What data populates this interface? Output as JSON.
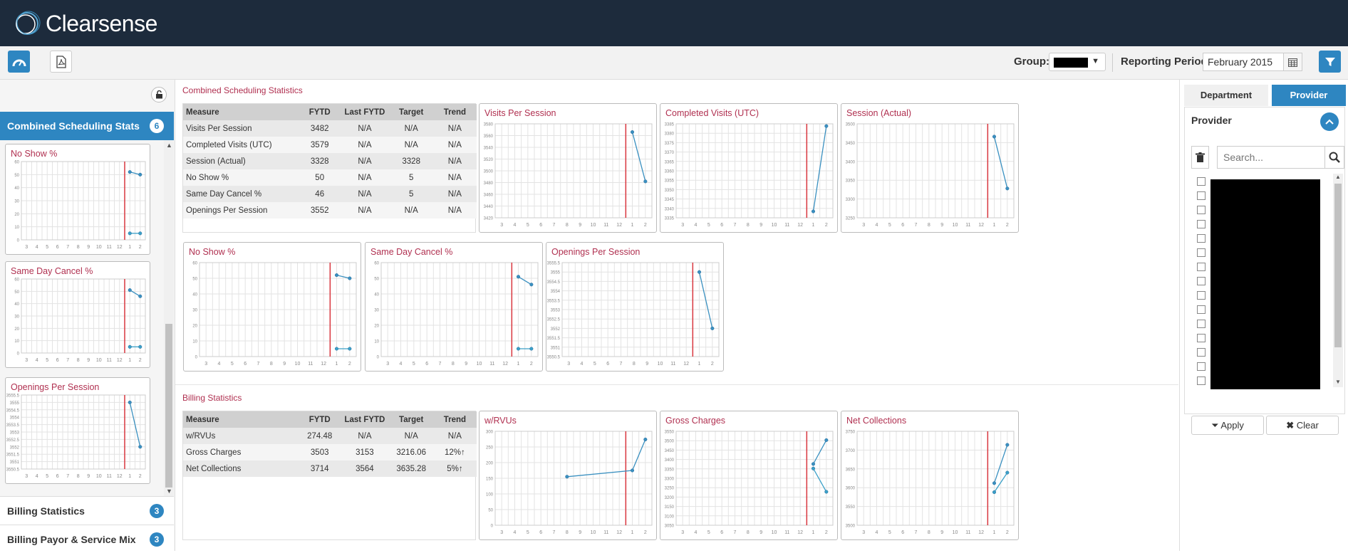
{
  "app": {
    "brand": "Clearsense"
  },
  "toolbar": {
    "group_label": "Group:",
    "period_label": "Reporting Period:",
    "period_value": "February 2015"
  },
  "colors": {
    "accent": "#2e86c1",
    "title": "#b03050",
    "redline": "#d9363e",
    "series": "#3a90c0"
  },
  "sidebar": {
    "selected": {
      "label": "Combined Scheduling Stats",
      "count": "6"
    },
    "items": [
      {
        "label": "Billing Statistics",
        "count": "3"
      },
      {
        "label": "Billing Payor & Service Mix",
        "count": "3"
      }
    ],
    "cards": [
      "No Show %",
      "Same Day Cancel %",
      "Openings Per Session"
    ]
  },
  "scheduling": {
    "title": "Combined Scheduling Statistics",
    "headers": [
      "Measure",
      "FYTD",
      "Last FYTD",
      "Target",
      "Trend"
    ],
    "rows": [
      [
        "Visits Per Session",
        "3482",
        "N/A",
        "N/A",
        "N/A"
      ],
      [
        "Completed Visits (UTC)",
        "3579",
        "N/A",
        "N/A",
        "N/A"
      ],
      [
        "Session (Actual)",
        "3328",
        "N/A",
        "3328",
        "N/A"
      ],
      [
        "No Show %",
        "50",
        "N/A",
        "5",
        "N/A"
      ],
      [
        "Same Day Cancel %",
        "46",
        "N/A",
        "5",
        "N/A"
      ],
      [
        "Openings Per Session",
        "3552",
        "N/A",
        "N/A",
        "N/A"
      ]
    ]
  },
  "billing": {
    "title": "Billing Statistics",
    "headers": [
      "Measure",
      "FYTD",
      "Last FYTD",
      "Target",
      "Trend"
    ],
    "rows": [
      [
        "w/RVUs",
        "274.48",
        "N/A",
        "N/A",
        "N/A"
      ],
      [
        "Gross Charges",
        "3503",
        "3153",
        "3216.06",
        "12%"
      ],
      [
        "Net Collections",
        "3714",
        "3564",
        "3635.28",
        "5%"
      ]
    ]
  },
  "chart_data": [
    {
      "id": "visits",
      "type": "line",
      "title": "Visits Per Session",
      "categories": [
        "3",
        "4",
        "5",
        "6",
        "7",
        "8",
        "9",
        "10",
        "11",
        "12",
        "1",
        "2"
      ],
      "ylim": [
        3420,
        3580
      ],
      "yticks": [
        "3420",
        "3440",
        "3460",
        "3480",
        "3500",
        "3520",
        "3540",
        "3560",
        "3580"
      ],
      "series": [
        {
          "x": [
            10,
            11
          ],
          "values": [
            3566,
            3482
          ]
        }
      ]
    },
    {
      "id": "completed",
      "type": "line",
      "title": "Completed Visits (UTC)",
      "categories": [
        "3",
        "4",
        "5",
        "6",
        "7",
        "8",
        "9",
        "10",
        "11",
        "12",
        "1",
        "2"
      ],
      "ylim": [
        3335,
        3585
      ],
      "yticks": [
        "3335",
        "3340",
        "3345",
        "3350",
        "3355",
        "3360",
        "3365",
        "3370",
        "3375",
        "3380",
        "3385"
      ],
      "series": [
        {
          "x": [
            10,
            11
          ],
          "values": [
            3352,
            3579
          ]
        }
      ]
    },
    {
      "id": "session",
      "type": "line",
      "title": "Session (Actual)",
      "categories": [
        "3",
        "4",
        "5",
        "6",
        "7",
        "8",
        "9",
        "10",
        "11",
        "12",
        "1",
        "2"
      ],
      "ylim": [
        3250,
        3500
      ],
      "yticks": [
        "3250",
        "3300",
        "3350",
        "3400",
        "3450",
        "3500"
      ],
      "series": [
        {
          "x": [
            10,
            11
          ],
          "values": [
            3466,
            3328
          ]
        }
      ]
    },
    {
      "id": "noshow",
      "type": "line",
      "title": "No Show %",
      "categories": [
        "3",
        "4",
        "5",
        "6",
        "7",
        "8",
        "9",
        "10",
        "11",
        "12",
        "1",
        "2"
      ],
      "ylim": [
        0,
        60
      ],
      "yticks": [
        "0",
        "10",
        "20",
        "30",
        "40",
        "50",
        "60"
      ],
      "series": [
        {
          "x": [
            10,
            11
          ],
          "values": [
            52,
            50
          ]
        },
        {
          "x": [
            10,
            11
          ],
          "values": [
            5,
            5
          ]
        }
      ]
    },
    {
      "id": "samedaycancel",
      "type": "line",
      "title": "Same Day Cancel %",
      "categories": [
        "3",
        "4",
        "5",
        "6",
        "7",
        "8",
        "9",
        "10",
        "11",
        "12",
        "1",
        "2"
      ],
      "ylim": [
        0,
        60
      ],
      "yticks": [
        "0",
        "10",
        "20",
        "30",
        "40",
        "50",
        "60"
      ],
      "series": [
        {
          "x": [
            10,
            11
          ],
          "values": [
            51,
            46
          ]
        },
        {
          "x": [
            10,
            11
          ],
          "values": [
            5,
            5
          ]
        }
      ]
    },
    {
      "id": "openings",
      "type": "line",
      "title": "Openings Per Session",
      "categories": [
        "3",
        "4",
        "5",
        "6",
        "7",
        "8",
        "9",
        "10",
        "11",
        "12",
        "1",
        "2"
      ],
      "ylim": [
        3550.5,
        3555.5
      ],
      "yticks": [
        "3550.5",
        "3551",
        "3551.5",
        "3552",
        "3552.5",
        "3553",
        "3553.5",
        "3554",
        "3554.5",
        "3555",
        "3555.5"
      ],
      "series": [
        {
          "x": [
            10,
            11
          ],
          "values": [
            3555,
            3552
          ]
        }
      ]
    },
    {
      "id": "wrvus",
      "type": "line",
      "title": "w/RVUs",
      "categories": [
        "3",
        "4",
        "5",
        "6",
        "7",
        "8",
        "9",
        "10",
        "11",
        "12",
        "1",
        "2"
      ],
      "ylim": [
        0,
        300
      ],
      "yticks": [
        "0",
        "50",
        "100",
        "150",
        "200",
        "250",
        "300"
      ],
      "series": [
        {
          "x": [
            5,
            10,
            11
          ],
          "values": [
            155,
            175,
            274
          ]
        }
      ]
    },
    {
      "id": "gross",
      "type": "line",
      "title": "Gross Charges",
      "categories": [
        "3",
        "4",
        "5",
        "6",
        "7",
        "8",
        "9",
        "10",
        "11",
        "12",
        "1",
        "2"
      ],
      "ylim": [
        3050,
        3550
      ],
      "yticks": [
        "3050",
        "3100",
        "3150",
        "3200",
        "3250",
        "3300",
        "3350",
        "3400",
        "3450",
        "3500",
        "3550"
      ],
      "series": [
        {
          "x": [
            10,
            11
          ],
          "values": [
            3376,
            3503
          ]
        },
        {
          "x": [
            10,
            11
          ],
          "values": [
            3352,
            3228
          ]
        }
      ]
    },
    {
      "id": "netcoll",
      "type": "line",
      "title": "Net Collections",
      "categories": [
        "3",
        "4",
        "5",
        "6",
        "7",
        "8",
        "9",
        "10",
        "11",
        "12",
        "1",
        "2"
      ],
      "ylim": [
        3500,
        3750
      ],
      "yticks": [
        "3500",
        "3550",
        "3600",
        "3650",
        "3700",
        "3750"
      ],
      "series": [
        {
          "x": [
            10,
            11
          ],
          "values": [
            3612,
            3714
          ]
        },
        {
          "x": [
            10,
            11
          ],
          "values": [
            3588,
            3640
          ]
        }
      ]
    }
  ],
  "sidebar_charts": [
    {
      "ref": "noshow",
      "yticks": [
        "0",
        "10",
        "20",
        "30",
        "40",
        "50",
        "60"
      ]
    },
    {
      "ref": "samedaycancel",
      "yticks": [
        "0",
        "10",
        "20",
        "30",
        "40",
        "50",
        "60"
      ]
    },
    {
      "ref": "openings",
      "yticks": [
        "3550.5",
        "3551",
        "3551.5",
        "3552",
        "3552.5",
        "3553",
        "3553.5",
        "3554",
        "3554.5",
        "3555",
        "3555.5"
      ]
    }
  ],
  "provider_panel": {
    "tabs": [
      "Department",
      "Provider"
    ],
    "heading": "Provider",
    "search_placeholder": "Search...",
    "apply_label": "Apply",
    "clear_label": "Clear"
  }
}
